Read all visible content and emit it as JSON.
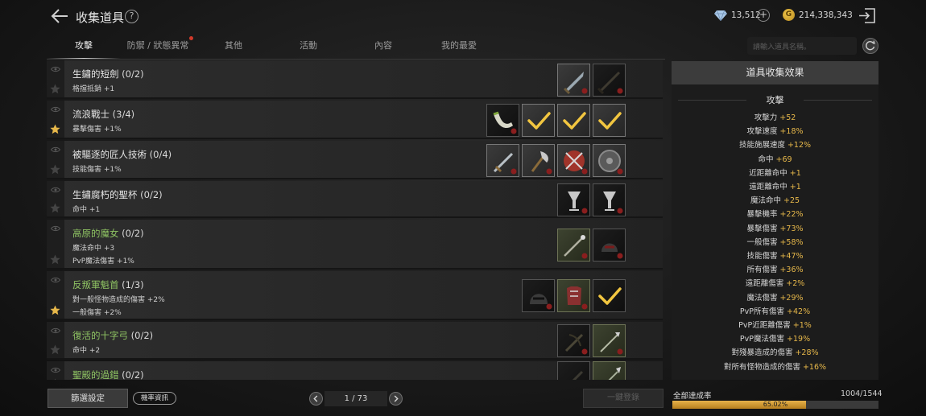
{
  "header": {
    "title": "收集道具",
    "help": "?",
    "diamonds": "13,512",
    "plus": "+",
    "gold_icon": "G",
    "gold": "214,338,343"
  },
  "tabs": [
    {
      "label": "攻擊",
      "active": true
    },
    {
      "label": "防禦 / 狀態異常",
      "active": false,
      "alert": true
    },
    {
      "label": "其他",
      "active": false
    },
    {
      "label": "活動",
      "active": false
    },
    {
      "label": "內容",
      "active": false
    },
    {
      "label": "我的最愛",
      "active": false
    }
  ],
  "search": {
    "placeholder": "請輸入道具名稱。"
  },
  "collections": [
    {
      "name": "生鏽的短劍",
      "count": "(0/2)",
      "green": false,
      "starred": false,
      "bonuses": [
        "格擋抵銷 +1"
      ],
      "items": [
        {
          "icon": "dagger-icon",
          "state": "owned",
          "registered": false
        },
        {
          "icon": "rusty-sword-icon",
          "state": "empty",
          "registered": false
        }
      ]
    },
    {
      "name": "流浪戰士",
      "count": "(3/4)",
      "green": false,
      "starred": true,
      "bonuses": [
        "暴擊傷害 +1%"
      ],
      "items": [
        {
          "icon": "horn-icon",
          "state": "empty",
          "registered": false
        },
        {
          "icon": "check-icon",
          "state": "owned",
          "registered": true
        },
        {
          "icon": "check-icon",
          "state": "owned",
          "registered": true
        },
        {
          "icon": "check-icon",
          "state": "owned",
          "registered": true
        }
      ]
    },
    {
      "name": "被驅逐的匠人技術",
      "count": "(0/4)",
      "green": false,
      "starred": false,
      "bonuses": [
        "技能傷害 +1%"
      ],
      "items": [
        {
          "icon": "sword-icon",
          "state": "owned",
          "registered": false
        },
        {
          "icon": "axe-icon",
          "state": "owned",
          "registered": false
        },
        {
          "icon": "red-shield-icon",
          "state": "owned",
          "registered": false
        },
        {
          "icon": "round-shield-icon",
          "state": "owned",
          "registered": false
        }
      ]
    },
    {
      "name": "生鏽腐朽的聖杯",
      "count": "(0/2)",
      "green": false,
      "starred": false,
      "bonuses": [
        "命中 +1"
      ],
      "items": [
        {
          "icon": "chalice-icon",
          "state": "empty",
          "registered": false
        },
        {
          "icon": "chalice-icon",
          "state": "empty",
          "registered": false
        }
      ]
    },
    {
      "name": "高原的魔女",
      "count": "(0/2)",
      "green": true,
      "starred": false,
      "bonuses": [
        "魔法命中 +3",
        "PvP魔法傷害 +1%"
      ],
      "items": [
        {
          "icon": "staff-icon",
          "state": "green",
          "registered": false
        },
        {
          "icon": "helmet-icon",
          "state": "empty",
          "registered": false
        }
      ]
    },
    {
      "name": "反叛軍魁首",
      "count": "(1/3)",
      "green": true,
      "starred": true,
      "bonuses": [
        "對一般怪物造成的傷害 +2%",
        "一般傷害 +2%"
      ],
      "items": [
        {
          "icon": "dark-helmet-icon",
          "state": "empty",
          "registered": false
        },
        {
          "icon": "armor-icon",
          "state": "green",
          "registered": false
        },
        {
          "icon": "check-icon",
          "state": "empty",
          "registered": true
        }
      ]
    },
    {
      "name": "復活的十字弓",
      "count": "(0/2)",
      "green": true,
      "starred": false,
      "bonuses": [
        "命中 +2"
      ],
      "items": [
        {
          "icon": "crossbow-icon",
          "state": "empty",
          "registered": false
        },
        {
          "icon": "bolt-icon",
          "state": "green",
          "registered": false
        }
      ]
    },
    {
      "name": "聖殿的過錯",
      "count": "(0/2)",
      "green": true,
      "starred": false,
      "bonuses": [],
      "items": [
        {
          "icon": "blade-icon",
          "state": "empty",
          "registered": false
        },
        {
          "icon": "spear-icon",
          "state": "green",
          "registered": false
        }
      ]
    }
  ],
  "effects": {
    "title": "道具收集效果",
    "category": "攻擊",
    "stats": [
      {
        "label": "攻擊力",
        "value": "+52"
      },
      {
        "label": "攻擊速度",
        "value": "+18%"
      },
      {
        "label": "技能施展速度",
        "value": "+12%"
      },
      {
        "label": "命中",
        "value": "+69"
      },
      {
        "label": "近距離命中",
        "value": "+1"
      },
      {
        "label": "遠距離命中",
        "value": "+1"
      },
      {
        "label": "魔法命中",
        "value": "+25"
      },
      {
        "label": "暴擊機率",
        "value": "+22%"
      },
      {
        "label": "暴擊傷害",
        "value": "+73%"
      },
      {
        "label": "一般傷害",
        "value": "+58%"
      },
      {
        "label": "技能傷害",
        "value": "+47%"
      },
      {
        "label": "所有傷害",
        "value": "+36%"
      },
      {
        "label": "遠距離傷害",
        "value": "+2%"
      },
      {
        "label": "魔法傷害",
        "value": "+29%"
      },
      {
        "label": "PvP所有傷害",
        "value": "+42%"
      },
      {
        "label": "PvP近距離傷害",
        "value": "+1%"
      },
      {
        "label": "PvP魔法傷害",
        "value": "+19%"
      },
      {
        "label": "對殘暴造成的傷害",
        "value": "+28%"
      },
      {
        "label": "對所有怪物造成的傷害",
        "value": "+16%"
      }
    ]
  },
  "footer": {
    "filter_label": "篩選設定",
    "probability_label": "機率資訊",
    "page": "1 / 73",
    "register_label": "一鍵登錄",
    "rate_label": "全部達成率",
    "rate_count": "1004/1544",
    "rate_percent_text": "65.02%",
    "rate_fraction": 0.6502
  },
  "colors": {
    "accent_gold": "#e7b84a",
    "green_name": "#8fc463",
    "alert_dot": "#d23a2a"
  }
}
